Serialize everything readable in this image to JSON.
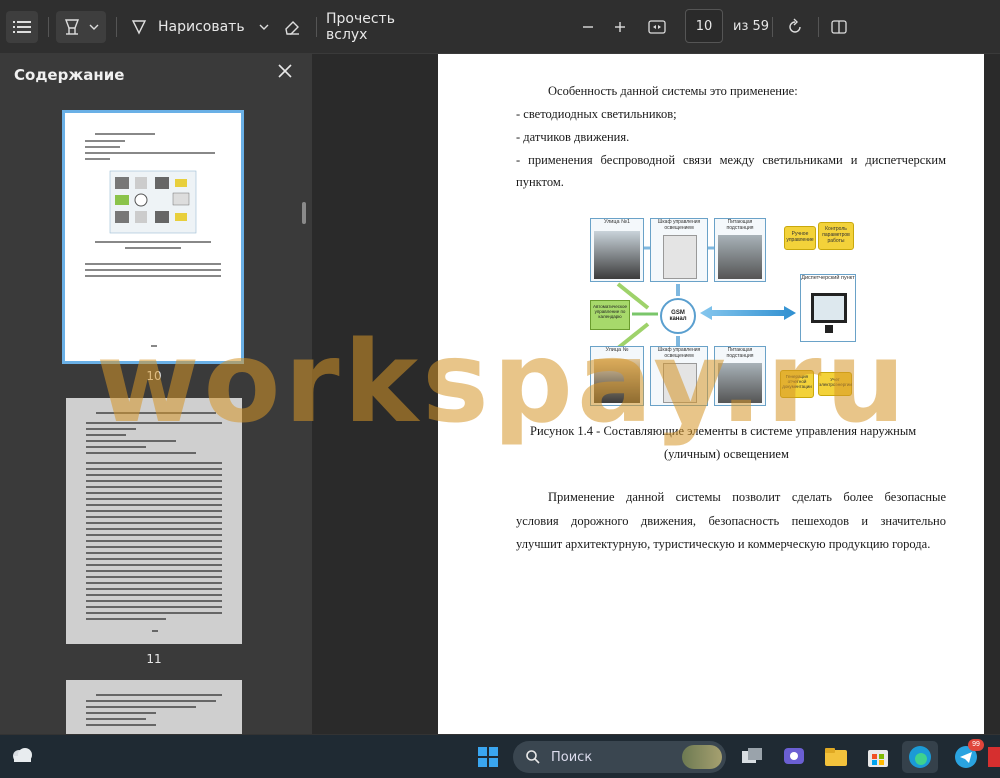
{
  "toolbar": {
    "draw_label": "Нарисовать",
    "read_aloud_label": "Прочесть вслух",
    "page_current": "10",
    "page_total": "из 59"
  },
  "sidebar": {
    "title": "Содержание",
    "thumbnails": [
      {
        "number": "10"
      },
      {
        "number": "11"
      }
    ]
  },
  "document": {
    "intro": "Особенность данной системы это применение:",
    "bullets": [
      "- светодиодных светильников;",
      "- датчиков движения.",
      "- применения беспроводной связи между светильниками и диспетчерским"
    ],
    "bullet_cont": "пунктом.",
    "figure": {
      "labels": {
        "street1": "Улица №1",
        "cabinet1": "Шкаф управления освещением",
        "substation1": "Питающая подстанция",
        "manual": "Ручное управление",
        "control": "Контроль параметров работы",
        "auto": "Автоматическое управление по календарю",
        "gsm": "GSM канал",
        "dispatch": "Диспетчерский пункт",
        "streetN": "Улица №",
        "cabinet2": "Шкаф управления освещением",
        "substation2": "Питающая подстанция",
        "reports": "Генерация отчетной документации",
        "energy": "Учет электроэнергии"
      },
      "caption_line1": "Рисунок 1.4 - Составляющие элементы в системе управления наружным",
      "caption_line2": "(уличным) освещением"
    },
    "para_lines": [
      "Применение данной системы позволит сделать более безопасные",
      "условия дорожного движения, безопасность пешеходов и значительно",
      "улучшит архитектурную, туристическую и коммерческую продукцию города."
    ]
  },
  "watermark": "workspay.ru",
  "taskbar": {
    "search_label": "Поиск",
    "telegram_badge": "99"
  },
  "colors": {
    "accent": "#4aa3df",
    "watermark": "#d69628",
    "page_bg": "#ffffff",
    "app_bg": "#2b2b2b"
  }
}
